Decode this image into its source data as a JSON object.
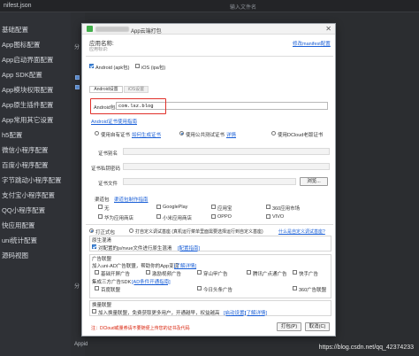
{
  "ide": {
    "file_tab": "nifest.json",
    "search_placeholder": "输入文件名",
    "sidebar": [
      "基础配置",
      "App图标配置",
      "App启动界面配置",
      "App SDK配置",
      "App模块权限配置",
      "App原生插件配置",
      "App常用其它设置",
      "h5配置",
      "微信小程序配置",
      "百度小程序配置",
      "字节跳动小程序配置",
      "支付宝小程序配置",
      "QQ小程序配置",
      "快应用配置",
      "uni统计配置",
      "源码视图"
    ],
    "mid_texts": [
      "分",
      "分",
      "请",
      "如",
      "源"
    ],
    "bottom_texts": [
      "Appid"
    ],
    "watermark": "https://blog.csdn.net/qq_42374233"
  },
  "dialog": {
    "title": "App云端打包",
    "close_glyph": "✕",
    "app_name_label": "应用名称:",
    "appid_label": "应用标识:",
    "manifest_link": "修改manifest配置",
    "android_check": "Android (apk包)",
    "ios_check": "iOS (ipa包)",
    "tab_android": "Android设置",
    "tab_ios": "iOS设置",
    "pkg_label": "Android包名",
    "pkg_value": "com.lsz.blog",
    "cert_link": "Android证书使用指南",
    "cert_options": [
      {
        "label": "使用自有证书",
        "link": "如何生成证书"
      },
      {
        "label": "使用公共测试证书",
        "link": "详情"
      },
      {
        "label": "使用DCloud老版证书",
        "link": ""
      }
    ],
    "cert_alias_label": "证书别名",
    "cert_pwd_label": "证书私钥密码",
    "cert_file_label": "证书文件",
    "browse_label": "浏览...",
    "channel_label": "渠道包",
    "channel_link": "渠道包制作指南",
    "channels": [
      "无",
      "GooglePlay",
      "应用宝",
      "360应用市场",
      "华为应用商店",
      "小米应用商店",
      "OPPO",
      "VIVO"
    ],
    "pack_formal": "打正式包",
    "pack_custom": "打自定义调试基座 (真机运行菜单里面需要选择运行到自定义基座)",
    "custom_link": "什么是自定义调试基座?",
    "native_section": "原生混淆",
    "native_text": "对配置的js/nvue文件进行原生混淆",
    "native_link": "[配置指南]",
    "ad_section": "广告联盟",
    "ad_desc": "加入uni-AD广告联盟，帮助你的App变现",
    "ad_link": "[了解详情]",
    "ad_options": [
      "基础开屏广告",
      "激励视频广告",
      "穿山甲广告",
      "腾讯广点通广告",
      "快手广告",
      "360广告联盟"
    ],
    "ad_third": "集成三方广告SDK",
    "ad_third_link": "[AD条件开通指南]",
    "ad_options2": [
      "百度联盟",
      "今日头条广告",
      "360广告联盟"
    ],
    "change_section": "换量联盟",
    "change_text": "加入换量联盟，免费获取更多用户，开通越早，权益越高",
    "change_link1": "[启动设置]",
    "change_link2": "[了解详情]",
    "footer_note": "注：DCloud或量券请不要随便上传您的证书及代码",
    "pack_button": "打包(P)",
    "cancel_button": "取消(C)"
  }
}
